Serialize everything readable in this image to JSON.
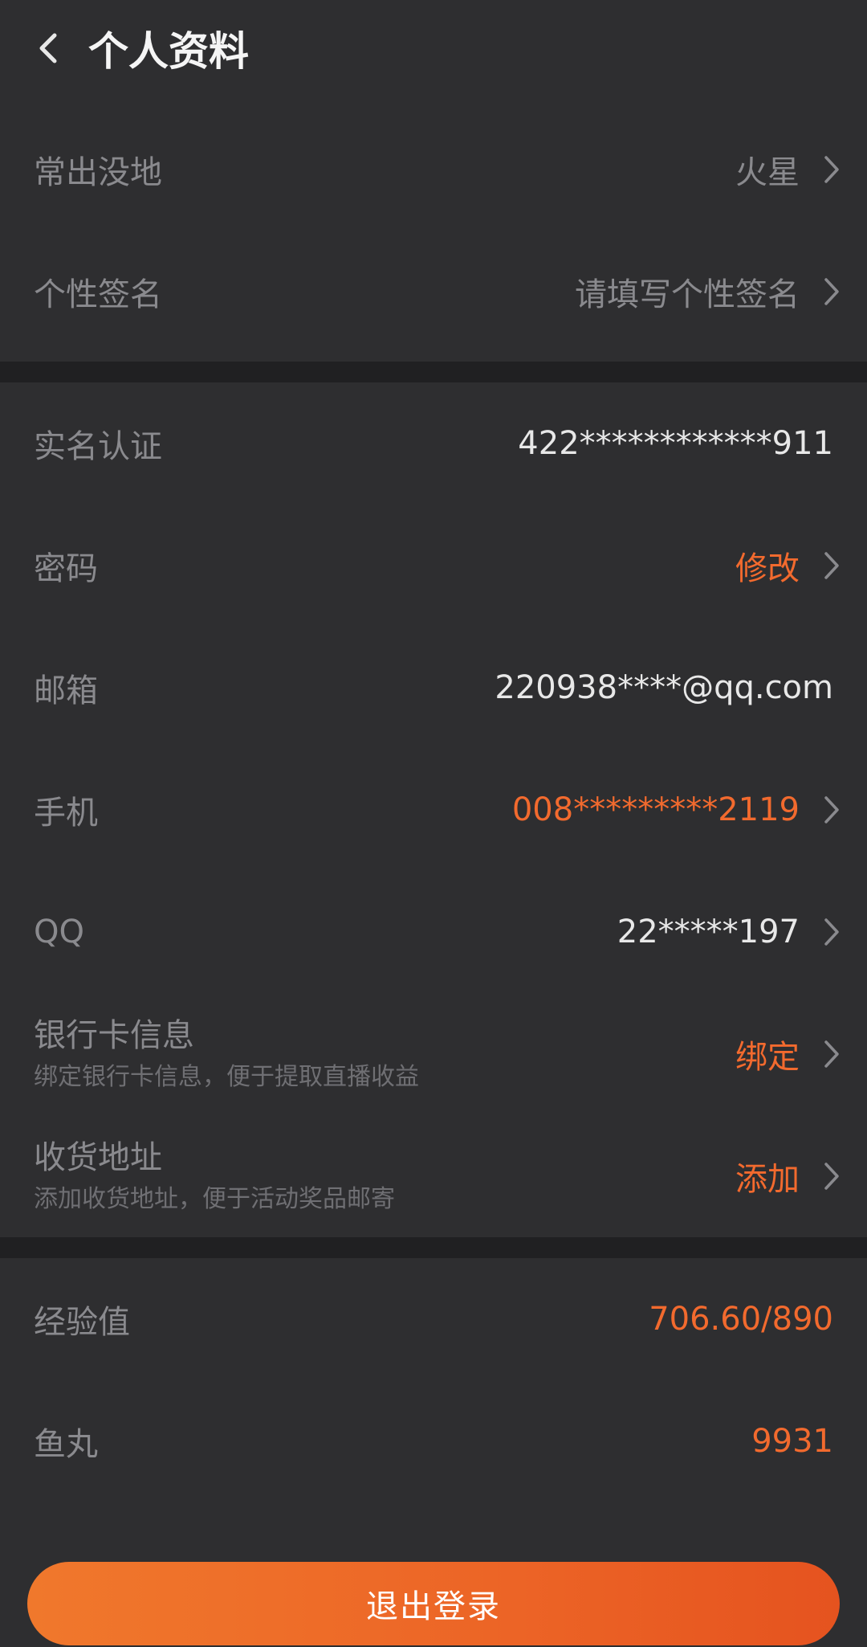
{
  "header": {
    "title": "个人资料",
    "back_icon": "chevron-left-icon"
  },
  "profile_rows": [
    {
      "label": "常出没地",
      "value": "火星",
      "value_color": "grey",
      "arrow": true
    },
    {
      "label": "个性签名",
      "value": "请填写个性签名",
      "value_color": "grey",
      "arrow": true
    }
  ],
  "account_rows": [
    {
      "label": "实名认证",
      "value": "422************911",
      "value_color": "white",
      "arrow": false
    },
    {
      "label": "密码",
      "value": "修改",
      "value_color": "orange",
      "arrow": true
    },
    {
      "label": "邮箱",
      "value": "220938****@qq.com",
      "value_color": "white",
      "arrow": false
    },
    {
      "label": "手机",
      "value": "008*********2119",
      "value_color": "orange",
      "arrow": true
    },
    {
      "label": "QQ",
      "value": "22*****197",
      "value_color": "white",
      "arrow": true
    },
    {
      "label": "银行卡信息",
      "sublabel": "绑定银行卡信息，便于提取直播收益",
      "value": "绑定",
      "value_color": "orange",
      "arrow": true
    },
    {
      "label": "收货地址",
      "sublabel": "添加收货地址，便于活动奖品邮寄",
      "value": "添加",
      "value_color": "orange",
      "arrow": true
    }
  ],
  "stats_rows": [
    {
      "label": "经验值",
      "value": "706.60/890",
      "value_color": "orange",
      "arrow": false
    },
    {
      "label": "鱼丸",
      "value": "9931",
      "value_color": "orange",
      "arrow": false
    }
  ],
  "logout": {
    "label": "退出登录"
  },
  "colors": {
    "background": "#2e2e30",
    "divider": "#202022",
    "label": "#8a8a8e",
    "accent": "#f26a2e",
    "value_white": "#e8e8e8"
  }
}
